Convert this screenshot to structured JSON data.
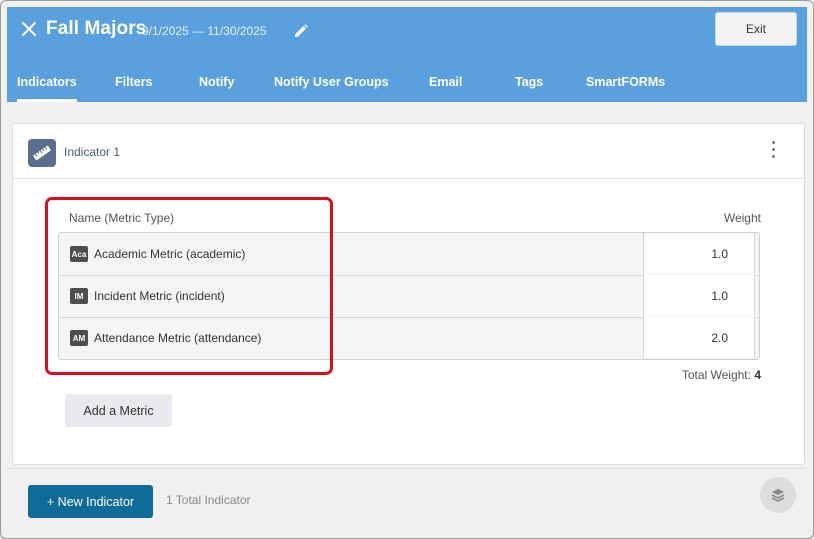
{
  "header": {
    "title": "Fall Majors",
    "dates": "9/1/2025 — 11/30/2025",
    "exit_label": "Exit"
  },
  "tabs": [
    {
      "label": "Indicators",
      "active": true
    },
    {
      "label": "Filters"
    },
    {
      "label": "Notify"
    },
    {
      "label": "Notify User Groups"
    },
    {
      "label": "Email"
    },
    {
      "label": "Tags"
    },
    {
      "label": "SmartFORMs"
    }
  ],
  "indicator": {
    "name": "Indicator 1",
    "col_name_header": "Name (Metric Type)",
    "col_weight_header": "Weight",
    "metrics": [
      {
        "badge": "Aca",
        "label": "Academic Metric (academic)",
        "weight": "1.0"
      },
      {
        "badge": "IM",
        "label": "Incident Metric (incident)",
        "weight": "1.0"
      },
      {
        "badge": "AM",
        "label": "Attendance Metric (attendance)",
        "weight": "2.0"
      }
    ],
    "total_label": "Total Weight:",
    "total_value": "4",
    "add_metric_label": "Add a Metric"
  },
  "footer": {
    "new_indicator_label": "+ New Indicator",
    "count_text": "1 Total Indicator"
  },
  "colors": {
    "header_bg": "#5a9fde",
    "primary_button": "#0f6b9a",
    "highlight": "#d6111d"
  }
}
